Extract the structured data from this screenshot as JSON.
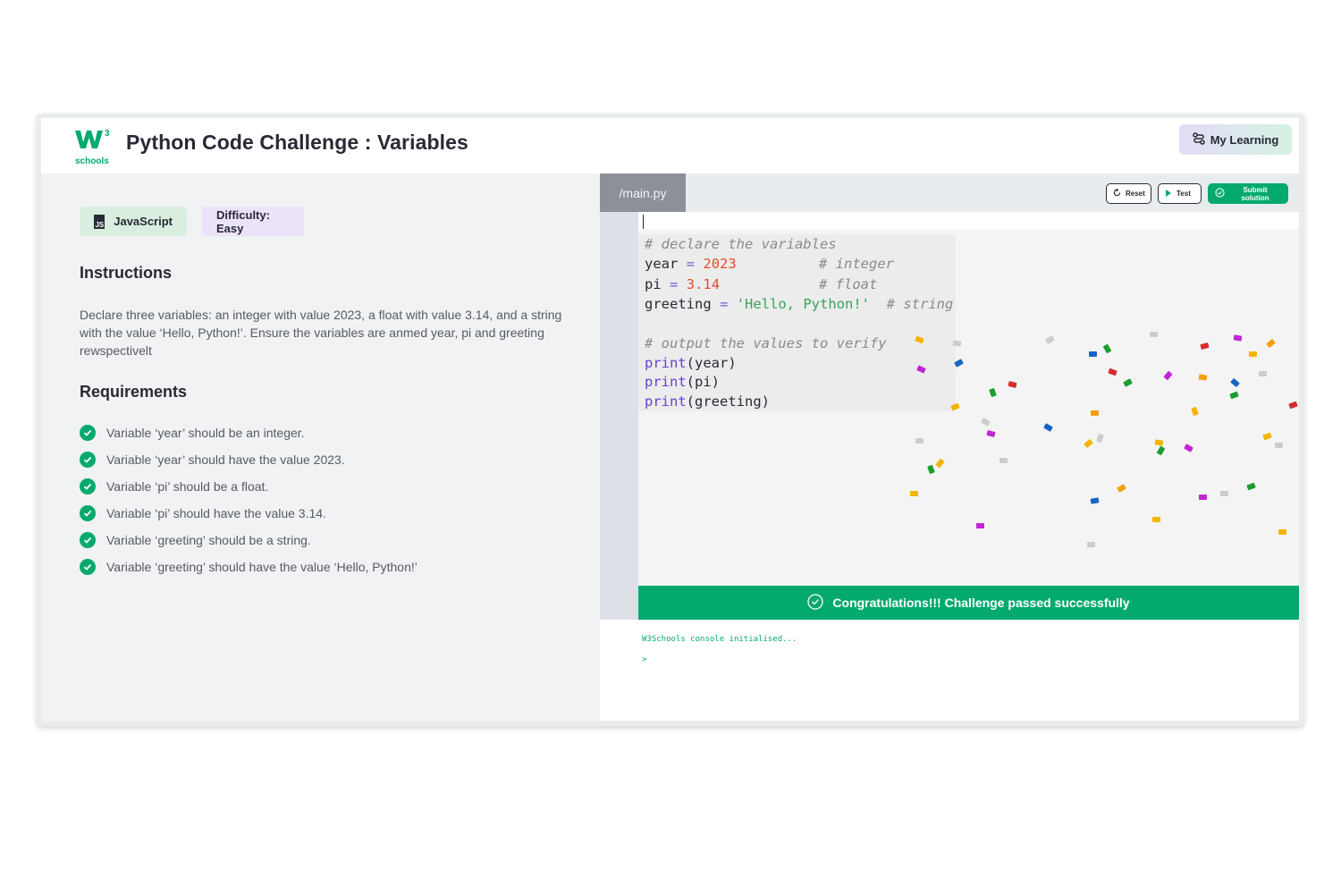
{
  "header": {
    "logo_sup": "3",
    "logo_text": "schools",
    "title": "Python Code Challenge : Variables",
    "my_learning_label": "My Learning"
  },
  "left": {
    "badge_language": "JavaScript",
    "badge_language_icon": "JS",
    "badge_difficulty": "Difficulty: Easy",
    "instructions_title": "Instructions",
    "instructions_text": "Declare three variables: an integer with value 2023, a float with value 3.14, and a string with the value ‘Hello, Python!’. Ensure the variables are anmed year, pi and greeting rewspectivelt",
    "requirements_title": "Requirements",
    "requirements": [
      "Variable ‘year’ should be an integer.",
      "Variable ‘year’ should have the value 2023.",
      "Variable ‘pi’ should be a float.",
      "Variable ‘pi’ should have the value 3.14.",
      "Variable ‘greeting’ should be a string.",
      "Variable ‘greeting’ should have the value ‘Hello, Python!’"
    ]
  },
  "editor": {
    "file_tab": "/main.py",
    "reset_label": "Reset",
    "test_label": "Test",
    "submit_label": "Submit solution",
    "code": {
      "comment1": "# declare the variables",
      "year_var": "year",
      "year_val": "2023",
      "year_comment": "# integer",
      "pi_var": "pi",
      "pi_val": "3.14",
      "pi_comment": "# float",
      "greeting_var": "greeting",
      "greeting_val": "'Hello, Python!'",
      "greeting_comment": "# string",
      "comment2": "# output the values to verify",
      "print_kw": "print",
      "print_arg1": "(year)",
      "print_arg2": "(pi)",
      "print_arg3": "(greeting)",
      "equals": "="
    },
    "success_message": "Congratulations!!! Challenge passed successfully",
    "console_line1": "W3Schools console initialised...",
    "console_prompt": ">"
  },
  "colors": {
    "accent_green": "#04aa6d",
    "text_dark": "#282a35"
  }
}
